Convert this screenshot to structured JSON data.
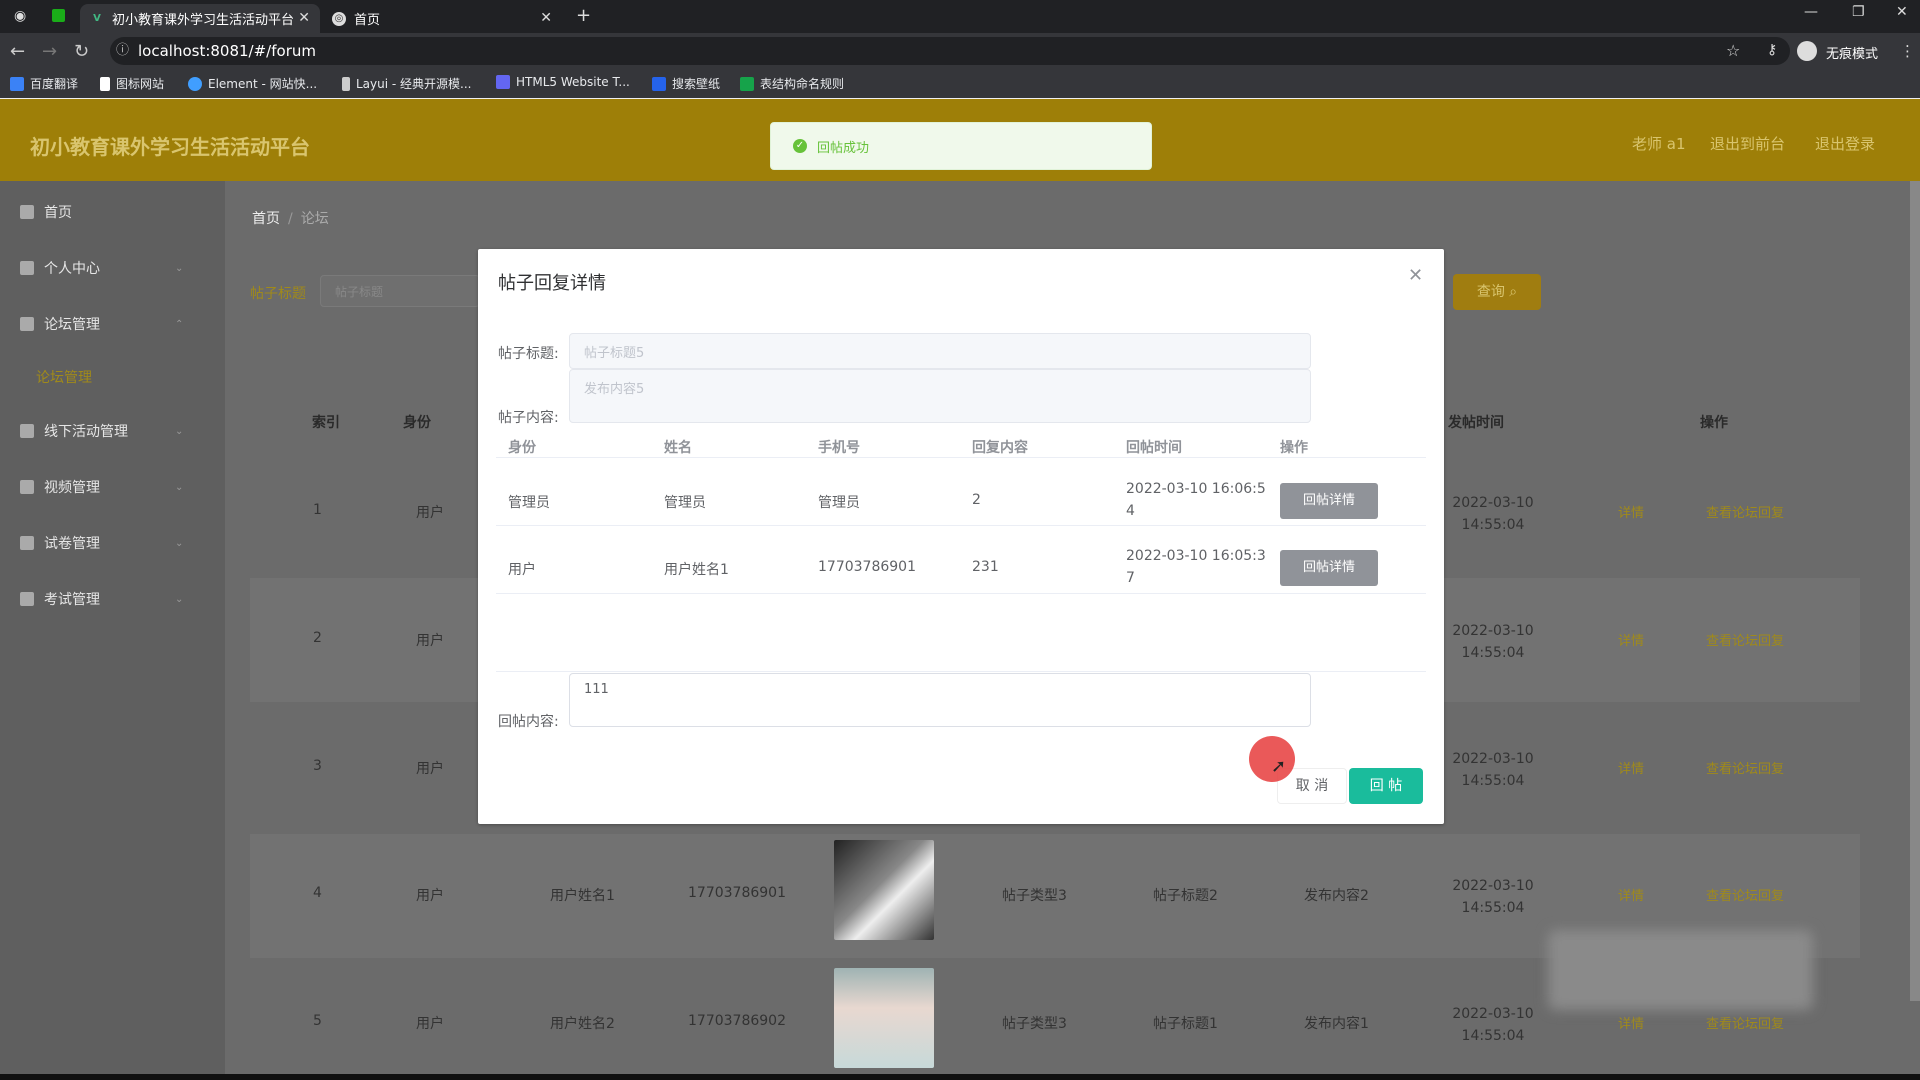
{
  "browser": {
    "tabs": [
      {
        "title": "初小教育课外学习生活活动平台",
        "active": true
      },
      {
        "title": "首页",
        "active": false
      }
    ],
    "url": "localhost:8081/#/forum",
    "profile": "无痕模式",
    "bookmarks": [
      "百度翻译",
      "图标网站",
      "Element - 网站快...",
      "Layui - 经典开源模...",
      "HTML5 Website T...",
      "搜索壁纸",
      "表结构命名规则"
    ]
  },
  "app": {
    "title": "初小教育课外学习生活活动平台",
    "header_links": [
      "老师 a1",
      "退出到前台",
      "退出登录"
    ]
  },
  "sidebar": {
    "items": [
      {
        "label": "首页"
      },
      {
        "label": "个人中心"
      },
      {
        "label": "论坛管理"
      },
      {
        "label": "论坛管理"
      },
      {
        "label": "线下活动管理"
      },
      {
        "label": "视频管理"
      },
      {
        "label": "试卷管理"
      },
      {
        "label": "考试管理"
      }
    ]
  },
  "breadcrumb": {
    "home": "首页",
    "current": "论坛"
  },
  "search": {
    "label": "帖子标题",
    "placeholder": "帖子标题",
    "button": "查询"
  },
  "table": {
    "headers": {
      "index": "索引",
      "identity": "身份",
      "post_time": "发帖时间",
      "actions": "操作"
    },
    "rows": [
      {
        "index": "1",
        "identity": "用户",
        "name": "",
        "phone": "",
        "type": "",
        "title": "",
        "content": "",
        "time": "2022-03-10 14:55:04",
        "detail": "详情",
        "view": "查看论坛回复"
      },
      {
        "index": "2",
        "identity": "用户",
        "name": "",
        "phone": "",
        "type": "",
        "title": "",
        "content": "",
        "time": "2022-03-10 14:55:04",
        "detail": "详情",
        "view": "查看论坛回复"
      },
      {
        "index": "3",
        "identity": "用户",
        "name": "",
        "phone": "",
        "type": "",
        "title": "",
        "content": "",
        "time": "2022-03-10 14:55:04",
        "detail": "详情",
        "view": "查看论坛回复"
      },
      {
        "index": "4",
        "identity": "用户",
        "name": "用户姓名1",
        "phone": "17703786901",
        "type": "帖子类型3",
        "title": "帖子标题2",
        "content": "发布内容2",
        "time": "2022-03-10 14:55:04",
        "detail": "详情",
        "view": "查看论坛回复"
      },
      {
        "index": "5",
        "identity": "用户",
        "name": "用户姓名2",
        "phone": "17703786902",
        "type": "帖子类型3",
        "title": "帖子标题1",
        "content": "发布内容1",
        "time": "2022-03-10 14:55:04",
        "detail": "详情",
        "view": "查看论坛回复"
      }
    ]
  },
  "toast": {
    "message": "回帖成功"
  },
  "dialog": {
    "title": "帖子回复详情",
    "post_title_label": "帖子标题:",
    "post_title_value": "帖子标题5",
    "post_content_label": "帖子内容:",
    "post_content_value": "发布内容5",
    "reply_table": {
      "headers": [
        "身份",
        "姓名",
        "手机号",
        "回复内容",
        "回帖时间",
        "操作"
      ],
      "rows": [
        {
          "identity": "管理员",
          "name": "管理员",
          "phone": "管理员",
          "content": "2",
          "time_line1": "2022-03-10 16:06:5",
          "time_line2": "4",
          "button": "回帖详情"
        },
        {
          "identity": "用户",
          "name": "用户姓名1",
          "phone": "17703786901",
          "content": "231",
          "time_line1": "2022-03-10 16:05:3",
          "time_line2": "7",
          "button": "回帖详情"
        }
      ]
    },
    "reply_label": "回帖内容:",
    "reply_value": "111",
    "cancel": "取 消",
    "submit": "回 帖"
  }
}
